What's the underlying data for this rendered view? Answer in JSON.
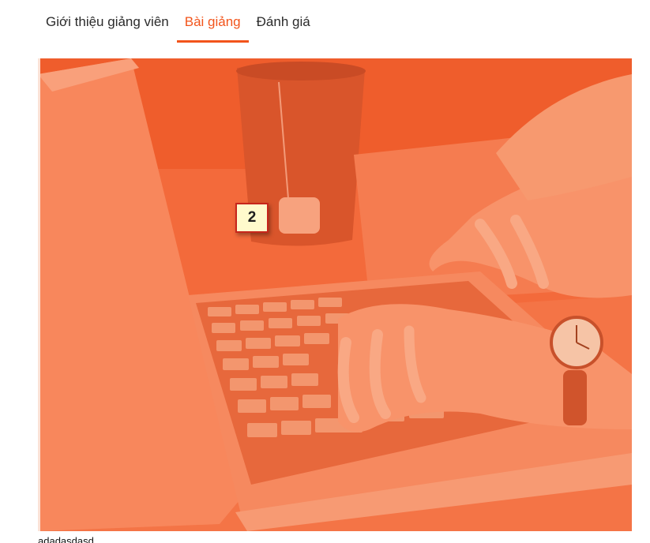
{
  "tabs": [
    {
      "label": "Giới thiệu giảng viên",
      "active": false
    },
    {
      "label": "Bài giảng",
      "active": true
    },
    {
      "label": "Đánh giá",
      "active": false
    }
  ],
  "media": {
    "image": "laptop-typing-photo",
    "overlay_color": "#f2541b"
  },
  "marker": {
    "label": "2"
  },
  "caption": "adadasdasd",
  "colors": {
    "accent": "#f2541b",
    "text": "#2b2b2b"
  }
}
